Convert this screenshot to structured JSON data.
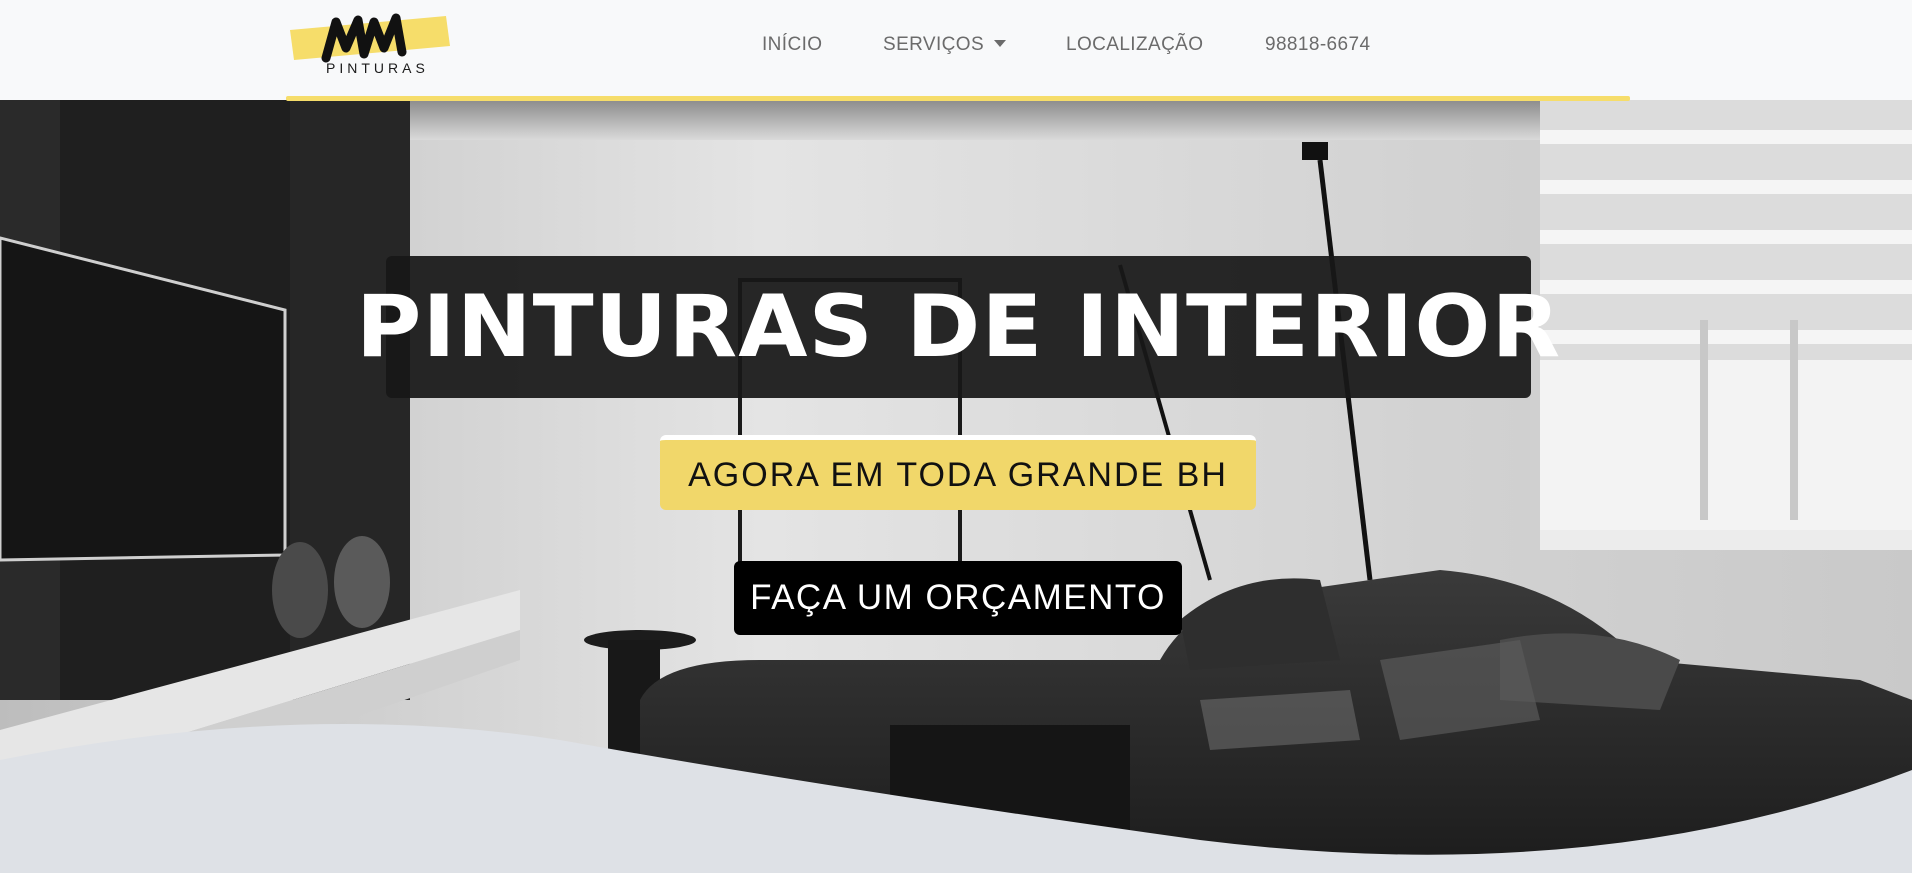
{
  "brand": {
    "logo_mark": "MM",
    "logo_sub": "PINTURAS",
    "accent_color": "#f1d76a"
  },
  "nav": {
    "items": [
      {
        "label": "INÍCIO"
      },
      {
        "label": "SERVIÇOS",
        "has_dropdown": true
      },
      {
        "label": "LOCALIZAÇÃO"
      },
      {
        "label": "98818-6674"
      }
    ]
  },
  "hero": {
    "headline": "PINTURAS DE INTERIOR",
    "tagline": "AGORA EM TODA GRANDE BH",
    "cta_label": "FAÇA UM ORÇAMENTO",
    "background": "living-room-photo"
  }
}
